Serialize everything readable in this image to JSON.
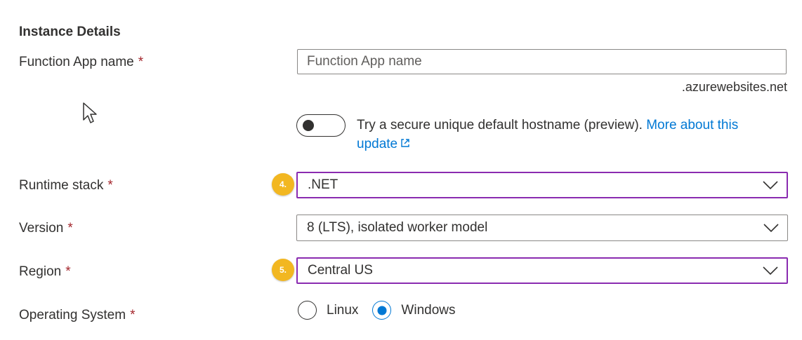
{
  "section": {
    "title": "Instance Details"
  },
  "required_marker": "*",
  "function_app_name": {
    "label": "Function App name",
    "placeholder": "Function App name",
    "value": "",
    "suffix": ".azurewebsites.net"
  },
  "hostname_toggle": {
    "state": "off",
    "text": "Try a secure unique default hostname (preview).",
    "link_text_1": "More about this",
    "link_text_2": "update",
    "link_icon": "external-link-icon"
  },
  "runtime_stack": {
    "label": "Runtime stack",
    "value": ".NET",
    "step_badge": "4."
  },
  "version": {
    "label": "Version",
    "value": "8 (LTS), isolated worker model"
  },
  "region": {
    "label": "Region",
    "value": "Central US",
    "step_badge": "5."
  },
  "operating_system": {
    "label": "Operating System",
    "options": [
      {
        "label": "Linux",
        "selected": false
      },
      {
        "label": "Windows",
        "selected": true
      }
    ]
  },
  "colors": {
    "text": "#323130",
    "required": "#a4262c",
    "link": "#0078d4",
    "highlight_border": "#8a2bb0",
    "step_badge": "#f2b721",
    "input_border": "#8a8886"
  }
}
